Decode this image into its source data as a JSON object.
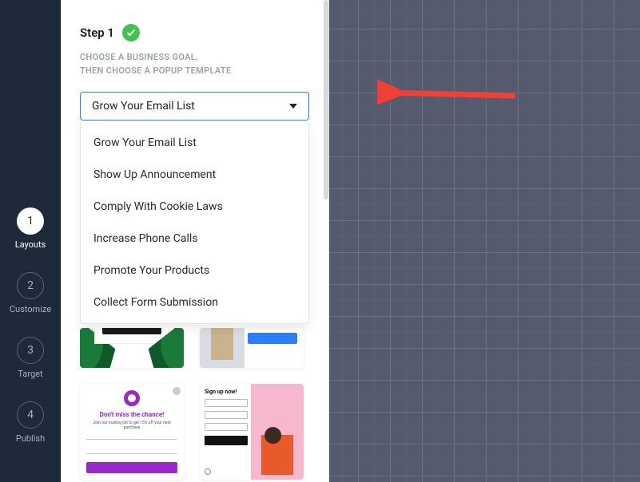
{
  "sidebar": {
    "steps": [
      {
        "number": "1",
        "label": "Layouts",
        "active": true
      },
      {
        "number": "2",
        "label": "Customize",
        "active": false
      },
      {
        "number": "3",
        "label": "Target",
        "active": false
      },
      {
        "number": "4",
        "label": "Publish",
        "active": false
      }
    ]
  },
  "panel": {
    "step_title": "Step 1",
    "check_icon": "check-icon",
    "subhead_line1": "CHOOSE A BUSINESS GOAL,",
    "subhead_line2": "THEN CHOOSE A POPUP TEMPLATE",
    "goal_dropdown": {
      "selected": "Grow Your Email List",
      "options": [
        "Grow Your Email List",
        "Show Up Announcement",
        "Comply With Cookie Laws",
        "Increase Phone Calls",
        "Promote Your Products",
        "Collect Form Submission"
      ]
    },
    "templates": {
      "tpl3_heading": "Don't miss the chance!",
      "tpl3_sub": "Join our mailing list to get 15% off your next purchase",
      "tpl4_heading": "Sign up now!"
    }
  },
  "annotation": {
    "arrow_color": "#ef4136"
  }
}
